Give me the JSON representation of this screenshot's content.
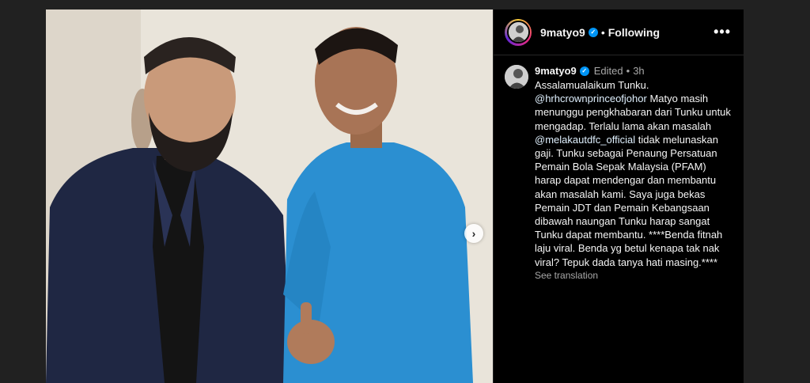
{
  "post": {
    "username": "9matyo9",
    "follow_status": "Following",
    "more_icon": "more-options-icon",
    "separator": "•"
  },
  "caption": {
    "username": "9matyo9",
    "edited": "Edited",
    "separator": "•",
    "time": "3h",
    "line1": "Assalamualaikum Tunku.",
    "mention1": "@hrhcrownprinceofjohor",
    "line2": " Matyo masih menunggu pengkhabaran dari Tunku untuk mengadap. Terlalu lama akan masalah ",
    "mention2": "@melakautdfc_official",
    "line3": " tidak melunaskan gaji. Tunku sebagai Penaung Persatuan Pemain Bola Sepak Malaysia (PFAM) harap dapat mendengar dan membantu akan masalah kami. Saya juga bekas Pemain JDT dan Pemain Kebangsaan dibawah naungan Tunku harap sangat Tunku dapat membantu. ****Benda fitnah laju viral. Benda yg betul kenapa tak nak viral? Tepuk dada tanya hati masing.****",
    "see_translation": "See translation"
  },
  "media": {
    "next_icon": "chevron-right-icon",
    "next_glyph": "›"
  }
}
